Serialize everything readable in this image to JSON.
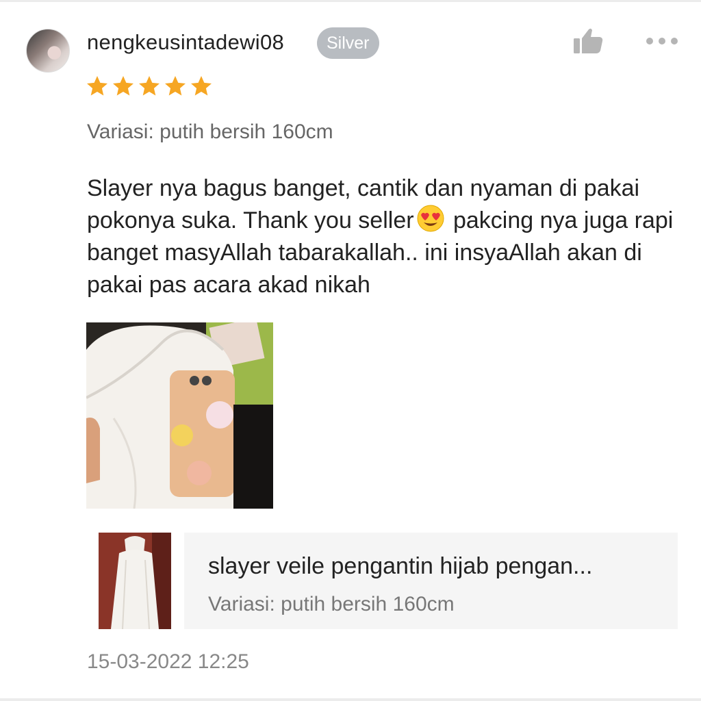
{
  "review": {
    "username": "nengkeusintadewi08",
    "badge": "Silver",
    "rating": 5,
    "max_rating": 5,
    "variation": "Variasi: putih bersih 160cm",
    "text_part1": "Slayer nya bagus banget, cantik dan nyaman di pakai pokonya suka. Thank you seller",
    "emoji": "😍",
    "text_part2": " pakcing nya juga rapi banget masyAllah tabarakallah.. ini insyaAllah akan di pakai pas acara akad nikah",
    "timestamp": "15-03-2022 12:25"
  },
  "product": {
    "title": "slayer veile pengantin hijab pengan...",
    "variation": "Variasi: putih bersih 160cm"
  },
  "icons": {
    "like": "thumbs-up-icon",
    "more": "more-dots-icon",
    "star": "star-icon"
  },
  "colors": {
    "star": "#f6a623",
    "badge_bg": "#b8bcc1",
    "icon_gray": "#b5b5b5",
    "product_card_bg": "#f5f5f5"
  }
}
